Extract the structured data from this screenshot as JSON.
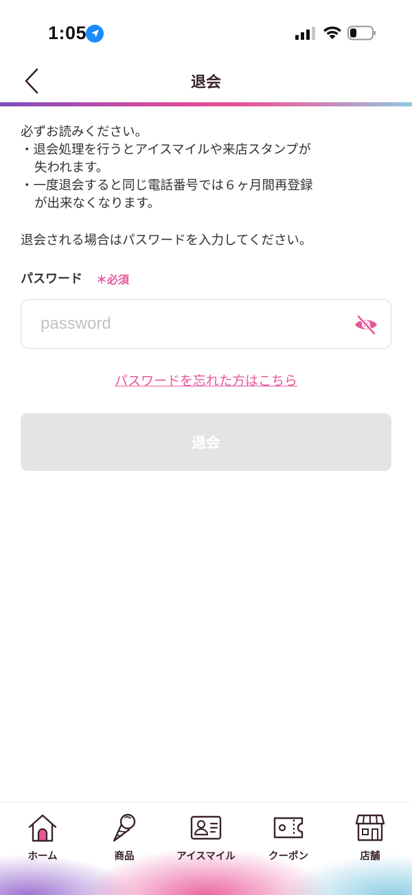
{
  "status_bar": {
    "time": "1:05"
  },
  "header": {
    "title": "退会"
  },
  "notice": {
    "lines": [
      "必ずお読みください。",
      "・退会処理を行うとアイスマイルや来店スタンプが",
      "失われます。",
      "・一度退会すると同じ電話番号では６ヶ月間再登録",
      "が出来なくなります。"
    ]
  },
  "instruction": "退会される場合はパスワードを入力してください。",
  "password": {
    "label": "パスワード",
    "required": "＊必須",
    "placeholder": "password",
    "value": ""
  },
  "forgot_link": "パスワードを忘れた方はこちら",
  "submit_button": "退会",
  "tabs": [
    {
      "label": "ホーム",
      "icon": "home-icon"
    },
    {
      "label": "商品",
      "icon": "ice-cream-icon"
    },
    {
      "label": "アイスマイル",
      "icon": "member-card-icon"
    },
    {
      "label": "クーポン",
      "icon": "coupon-ticket-icon"
    },
    {
      "label": "店舗",
      "icon": "store-icon"
    }
  ],
  "colors": {
    "accent": "#e8569a",
    "button_disabled": "#e3e4e4",
    "title_text": "#3a2328"
  }
}
